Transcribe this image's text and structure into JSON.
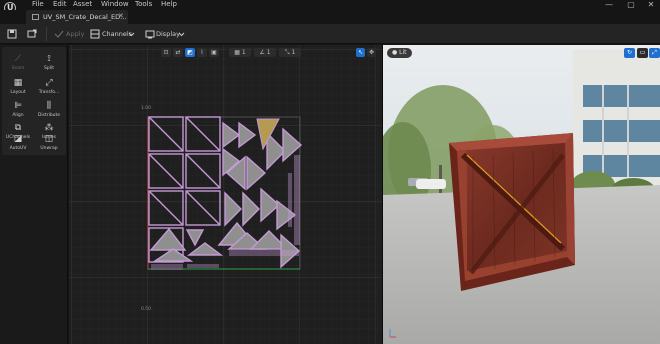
{
  "menu": {
    "items": [
      "File",
      "Edit",
      "Asset",
      "Window",
      "Tools",
      "Help"
    ]
  },
  "window_controls": {
    "minimize": "—",
    "maximize": "▢",
    "close": "✕"
  },
  "tab": {
    "title": "UV_SM_Crate_Decal_ED...",
    "close": "✕"
  },
  "toolbar": {
    "apply_label": "Apply",
    "channels_label": "Channels",
    "display_label": "Display"
  },
  "tools": [
    {
      "label": "Seam",
      "icon": "seam-icon",
      "enabled": false
    },
    {
      "label": "Split",
      "icon": "split-icon",
      "enabled": true
    },
    {
      "label": "Layout",
      "icon": "layout-icon",
      "enabled": true
    },
    {
      "label": "Transfo...",
      "icon": "transform-icon",
      "enabled": true
    },
    {
      "label": "Align",
      "icon": "align-icon",
      "enabled": true
    },
    {
      "label": "Distribute",
      "icon": "distribute-icon",
      "enabled": true
    },
    {
      "label": "UChannels",
      "icon": "channels-icon",
      "enabled": true
    },
    {
      "label": "Issues",
      "icon": "issues-icon",
      "enabled": true
    },
    {
      "label": "AutoUV",
      "icon": "autouv-icon",
      "enabled": true
    },
    {
      "label": "Unwrap",
      "icon": "unwrap-icon",
      "enabled": true
    }
  ],
  "uv_viewport": {
    "grid_value": "1",
    "snap_value": "1",
    "axis_labels": [
      "1.00",
      "0.50"
    ],
    "colors": {
      "background": "#1f1f1f",
      "grid_fine": "#2a2a2a",
      "grid_major": "#3a3a3a",
      "uv_edge": "#c49ad4",
      "uv_fill": "#8f8f8f",
      "uv_selected": "#b59a52",
      "unit_square": "#5a5a5a",
      "v_axis": "#b03a3a",
      "u_axis": "#2fa24a"
    }
  },
  "live_viewport": {
    "view_mode": "Lit",
    "colors": {
      "crate_wood": "#7a2f24",
      "crate_frame": "#a2473a",
      "selected_edge": "#e09a1e",
      "sky": "#dfe6ea",
      "floor": "#b5b7b6"
    }
  }
}
